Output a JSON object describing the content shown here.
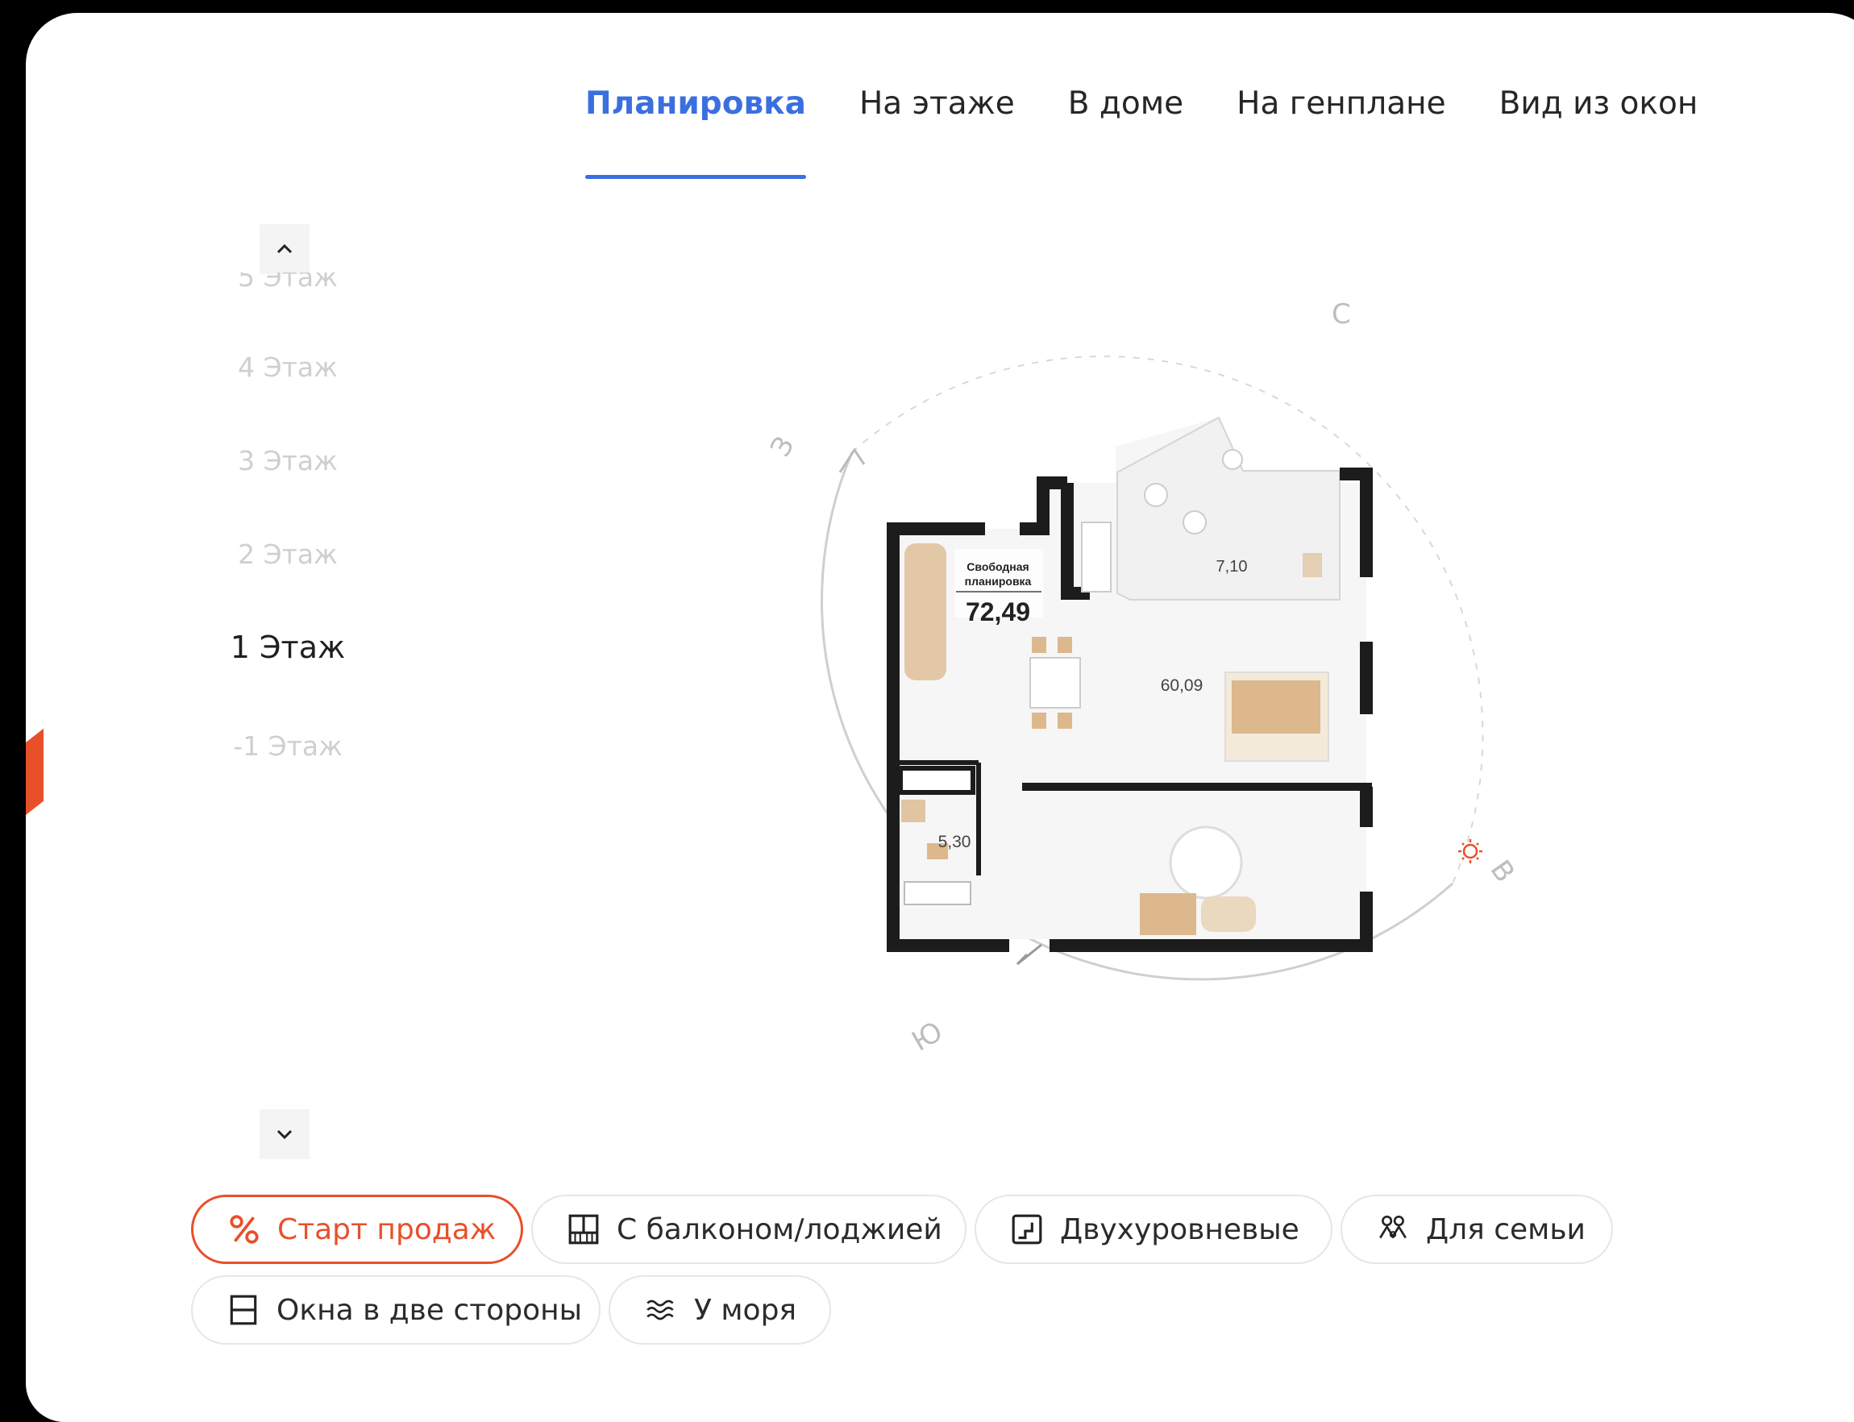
{
  "tabs": [
    {
      "label": "Планировка",
      "active": true
    },
    {
      "label": "На этаже",
      "active": false
    },
    {
      "label": "В доме",
      "active": false
    },
    {
      "label": "На генплане",
      "active": false
    },
    {
      "label": "Вид из окон",
      "active": false
    }
  ],
  "floors": [
    {
      "label": "5 Этаж",
      "state": "clipped"
    },
    {
      "label": "4 Этаж",
      "state": "inactive"
    },
    {
      "label": "3 Этаж",
      "state": "inactive"
    },
    {
      "label": "2 Этаж",
      "state": "inactive"
    },
    {
      "label": "1 Этаж",
      "state": "active"
    },
    {
      "label": "-1 Этаж",
      "state": "inactive"
    }
  ],
  "compass": {
    "north": "С",
    "east": "В",
    "south": "Ю",
    "west": "З"
  },
  "plan": {
    "badge_line1": "Свободная",
    "badge_line2": "планировка",
    "total_area": "72,49",
    "room_areas": [
      "7,10",
      "60,09",
      "5,30"
    ]
  },
  "tags": [
    {
      "label": "Старт продаж",
      "icon": "percent-icon",
      "highlight": true
    },
    {
      "label": "С балконом/лоджией",
      "icon": "balcony-icon",
      "highlight": false
    },
    {
      "label": "Двухуровневые",
      "icon": "stairs-icon",
      "highlight": false
    },
    {
      "label": "Для семьи",
      "icon": "family-icon",
      "highlight": false
    },
    {
      "label": "Окна в две стороны",
      "icon": "windows-icon",
      "highlight": false
    },
    {
      "label": "У моря",
      "icon": "waves-icon",
      "highlight": false
    }
  ],
  "colors": {
    "accent_blue": "#3b6fe0",
    "accent_orange": "#e8502a",
    "furniture": "#dcb88c"
  }
}
